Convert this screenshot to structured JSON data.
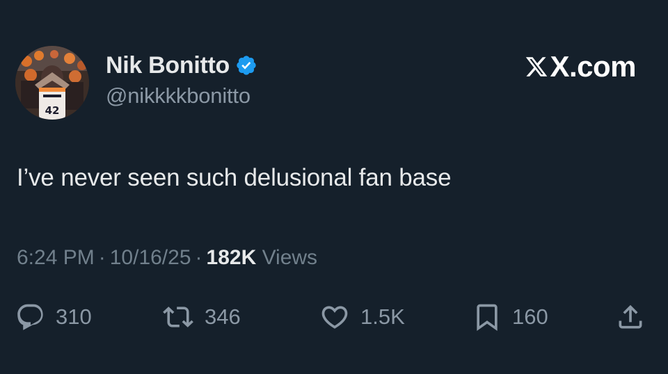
{
  "author": {
    "display_name": "Nik Bonitto",
    "handle": "@nikkkkbonitto",
    "verified": true,
    "avatar_jersey_number": "42"
  },
  "brand": {
    "text": "X.com",
    "logo_icon": "x-logo-icon"
  },
  "tweet": {
    "text": "I’ve never seen such delusional fan base"
  },
  "meta": {
    "time": "6:24 PM",
    "separator": "·",
    "date": "10/16/25",
    "views_count": "182K",
    "views_label": "Views"
  },
  "actions": {
    "replies": "310",
    "reposts": "346",
    "likes": "1.5K",
    "bookmarks": "160"
  },
  "colors": {
    "background": "#15202b",
    "verified_badge": "#1d9bf0",
    "primary_text": "#e7e9ea",
    "secondary_text": "#8b98a5"
  }
}
